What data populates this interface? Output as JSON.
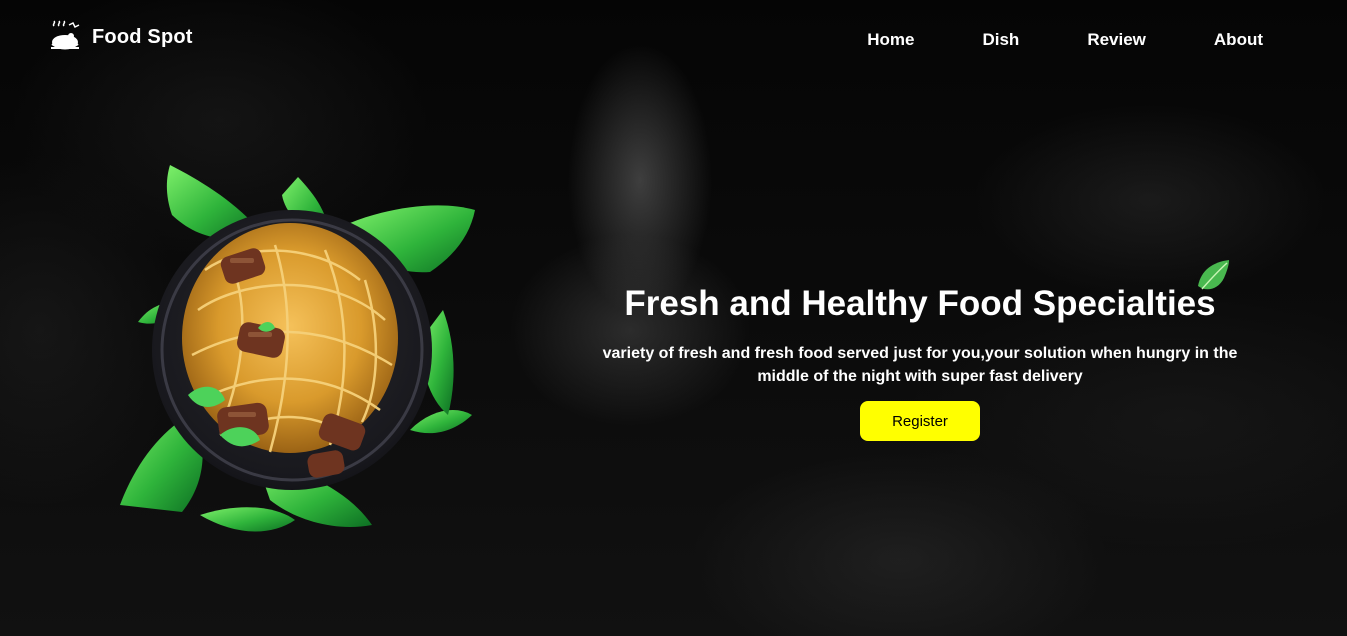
{
  "brand": {
    "name": "Food Spot",
    "icon": "chef-dish-icon"
  },
  "nav": {
    "items": [
      {
        "label": "Home"
      },
      {
        "label": "Dish"
      },
      {
        "label": "Review"
      },
      {
        "label": "About"
      }
    ]
  },
  "hero": {
    "title": "Fresh and Healthy Food Specialties",
    "subtitle": "variety of fresh and fresh food served just for you,your solution when hungry in the middle of the night with super fast delivery",
    "cta_label": "Register"
  },
  "media": {
    "main_image": "noodles-with-beef-and-leaves",
    "accent_icon": "leaf-icon"
  },
  "colors": {
    "background": "#050505",
    "accent": "#ffff00",
    "text": "#ffffff",
    "leaf": "#2fb43b"
  }
}
